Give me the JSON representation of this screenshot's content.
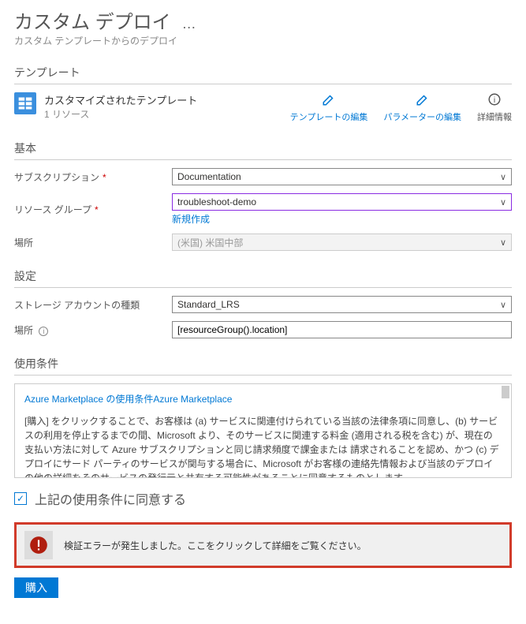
{
  "header": {
    "title": "カスタム デプロイ",
    "ellipsis": "…",
    "subtitle": "カスタム テンプレートからのデプロイ"
  },
  "sections": {
    "template": "テンプレート",
    "basic": "基本",
    "settings": "設定",
    "terms": "使用条件"
  },
  "template": {
    "name": "カスタマイズされたテンプレート",
    "resources": "1 リソース",
    "actions": {
      "edit_template": "テンプレートの編集",
      "edit_params": "パラメーターの編集",
      "more_info": "詳細情報"
    }
  },
  "basic": {
    "subscription_label": "サブスクリプション",
    "subscription_value": "Documentation",
    "resource_group_label": "リソース グループ",
    "resource_group_value": "troubleshoot-demo",
    "create_new": "新規作成",
    "location_label": "場所",
    "location_value": "(米国) 米国中部"
  },
  "settings": {
    "storage_type_label": "ストレージ アカウントの種類",
    "storage_type_value": "Standard_LRS",
    "location_label": "場所",
    "location_value": "[resourceGroup().location]"
  },
  "terms": {
    "marketplace_link_pre": "Azure Marketplace の使用条件",
    "marketplace_link": "Azure Marketplace",
    "body": "[購入] をクリックすることで、お客様は (a) サービスに関連付けられている当該の法律条項に同意し、(b) サービスの利用を停止するまでの間、Microsoft より、そのサービスに関連する料金 (適用される税を含む) が、現在の支払い方法に対して Azure サブスクリプションと同じ請求頻度で課金または 請求されることを認め、かつ (c) デプロイにサード パーティのサービスが関与する場合に、Microsoft がお客様の連絡先情報および当該のデプロイの他の詳細をそのサービスの発行元と共有する可能性があることに同意するものとします。",
    "agree_label": "上記の使用条件に同意する"
  },
  "error": {
    "message": "検証エラーが発生しました。ここをクリックして詳細をご覧ください。"
  },
  "buttons": {
    "purchase": "購入"
  }
}
